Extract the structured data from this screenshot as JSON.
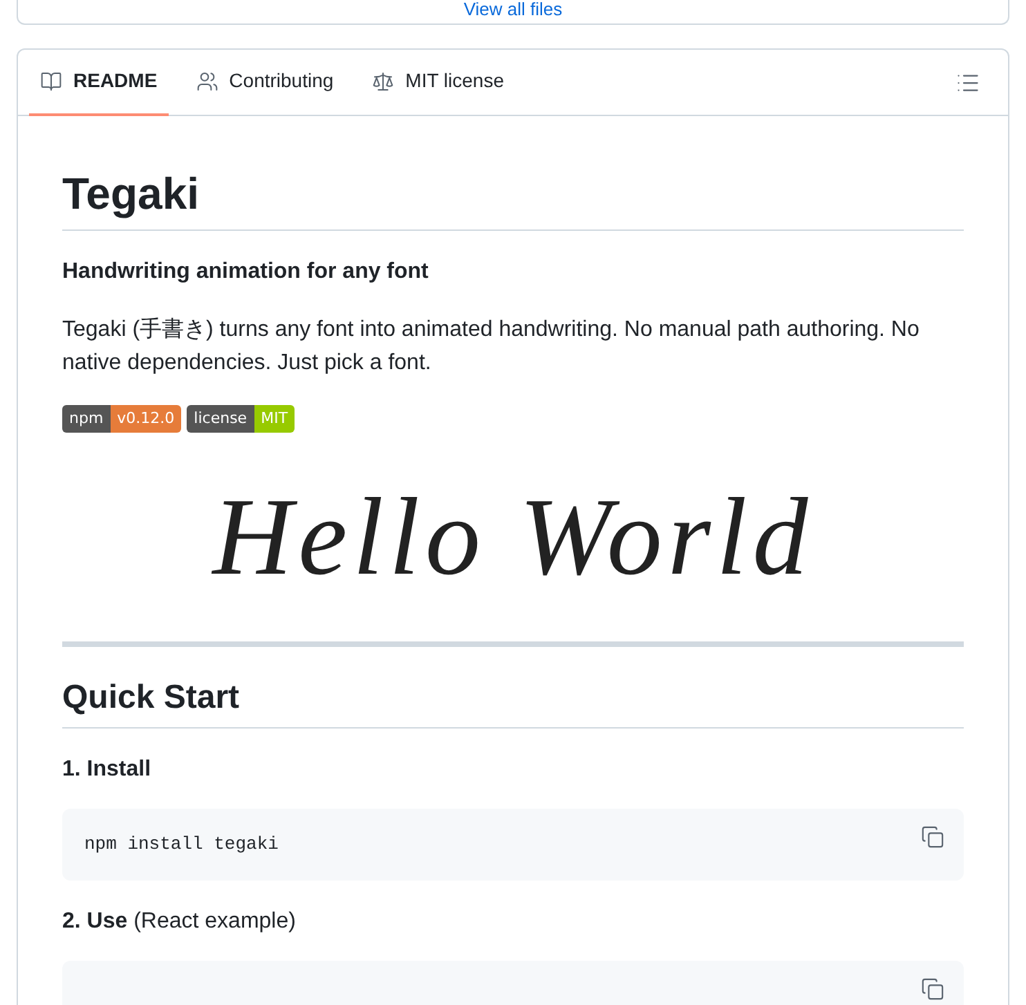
{
  "top_card": {
    "link": "View all files"
  },
  "tabs": [
    {
      "label": "README",
      "kind": "book",
      "selected": true
    },
    {
      "label": "Contributing",
      "kind": "people",
      "selected": false
    },
    {
      "label": "MIT license",
      "kind": "scale",
      "selected": false
    }
  ],
  "readme": {
    "title": "Tegaki",
    "subtitle": "Handwriting animation for any font",
    "intro": "Tegaki (手書き) turns any font into animated handwriting. No manual path authoring. No native dependencies. Just pick a font.",
    "badges": [
      {
        "label": "npm",
        "value": "v0.12.0",
        "color": "#e67c3a"
      },
      {
        "label": "license",
        "value": "MIT",
        "color": "#97ca00"
      }
    ],
    "hero_text": "Hello World",
    "section_title": "Quick Start",
    "steps": [
      {
        "title": "1. Install",
        "code": "npm install tegaki"
      },
      {
        "title": "2. Use",
        "note": "(React example)"
      }
    ]
  }
}
